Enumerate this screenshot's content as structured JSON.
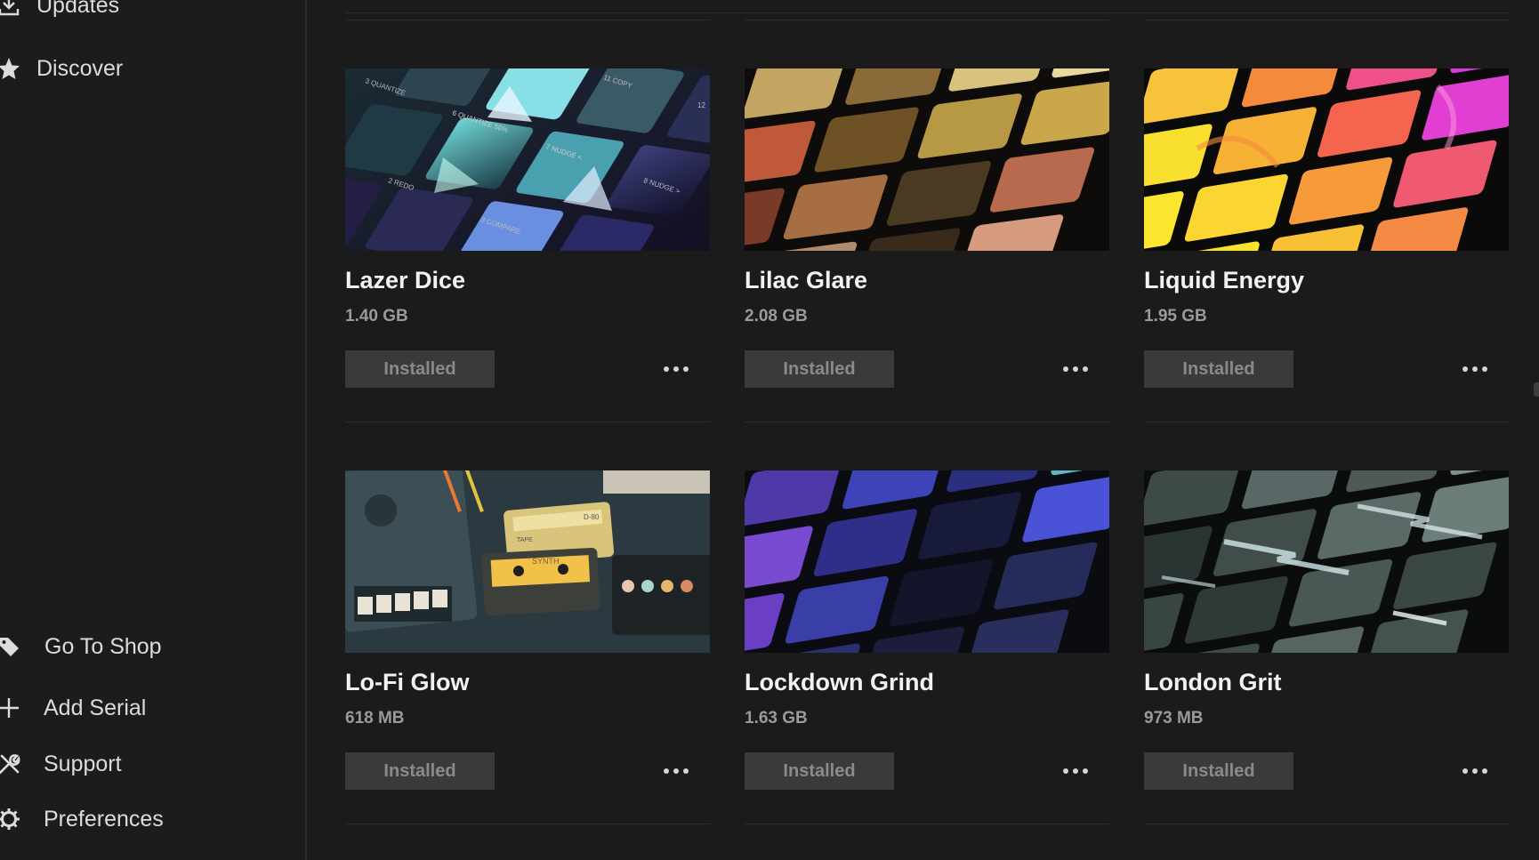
{
  "sidebar": {
    "top_items": [
      {
        "label": "Updates",
        "icon": "download-icon"
      },
      {
        "label": "Discover",
        "icon": "star-icon"
      }
    ],
    "bottom_items": [
      {
        "label": "Go To Shop",
        "icon": "tag-icon"
      },
      {
        "label": "Add Serial",
        "icon": "plus-icon"
      },
      {
        "label": "Support",
        "icon": "tools-icon"
      },
      {
        "label": "Preferences",
        "icon": "gear-icon"
      }
    ]
  },
  "cards": [
    {
      "title": "Lazer Dice",
      "size": "1.40 GB",
      "status": "Installed",
      "theme": "lazer"
    },
    {
      "title": "Lilac Glare",
      "size": "2.08 GB",
      "status": "Installed",
      "theme": "lilac"
    },
    {
      "title": "Liquid Energy",
      "size": "1.95 GB",
      "status": "Installed",
      "theme": "liquid"
    },
    {
      "title": "Lo-Fi Glow",
      "size": "618 MB",
      "status": "Installed",
      "theme": "lofi"
    },
    {
      "title": "Lockdown Grind",
      "size": "1.63 GB",
      "status": "Installed",
      "theme": "lockdown"
    },
    {
      "title": "London Grit",
      "size": "973 MB",
      "status": "Installed",
      "theme": "london"
    }
  ],
  "thumbnail_text": {
    "lazer": [
      "3 QUANTIZE",
      "11 COPY",
      "6 QUANTIZE 50%",
      "7 NUDGE <",
      "2 REDO",
      "8 NUDGE >",
      "3 COMPARE",
      "12"
    ],
    "lofi": [
      "D-80",
      "TAPE",
      "SYNTH"
    ]
  },
  "colors": {
    "background": "#1b1b1b",
    "button_bg": "#3a3a3a",
    "button_text": "#8a8a8a",
    "title_text": "#f2f2f2",
    "size_text": "#9a9a9a"
  }
}
